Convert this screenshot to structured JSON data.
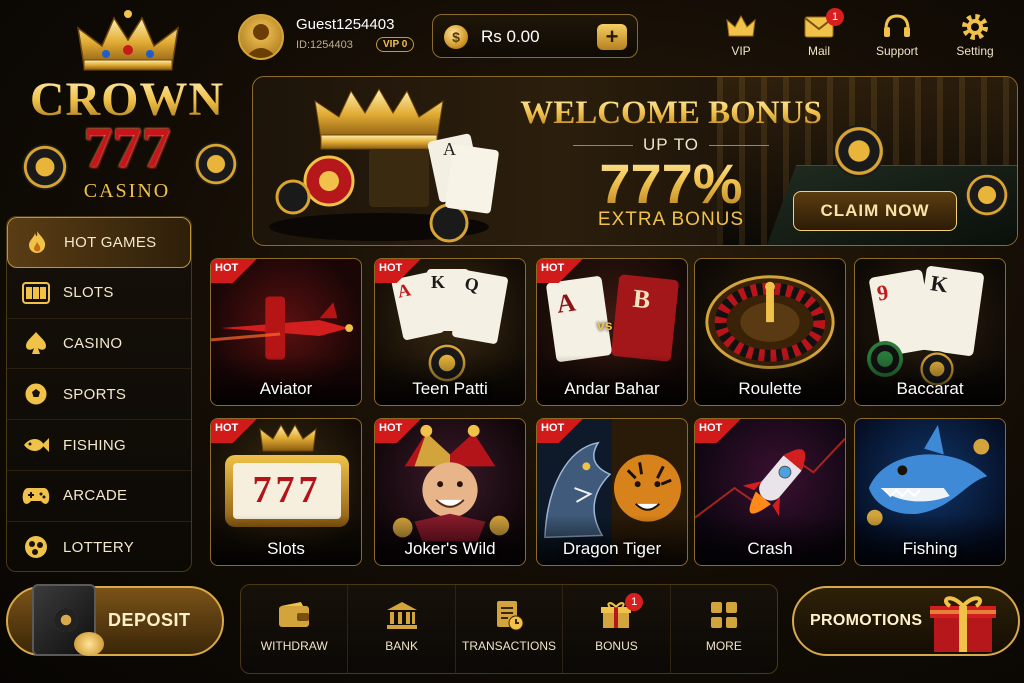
{
  "logo": {
    "word1": "CROWN",
    "word2": "777",
    "word3": "CASINO"
  },
  "user": {
    "name": "Guest1254403",
    "id": "ID:1254403",
    "vip": "VIP 0"
  },
  "balance": {
    "value": "Rs 0.00",
    "currency_icon": "dollar-coin-icon",
    "add_label": "+"
  },
  "top_nav": [
    {
      "label": "VIP",
      "icon": "crown-icon"
    },
    {
      "label": "Mail",
      "icon": "mail-icon",
      "badge": "1"
    },
    {
      "label": "Support",
      "icon": "headset-icon"
    },
    {
      "label": "Setting",
      "icon": "gear-icon"
    }
  ],
  "banner": {
    "title": "WELCOME BONUS",
    "subtitle": "UP TO",
    "amount": "777%",
    "extra": "EXTRA BONUS",
    "cta": "CLAIM NOW",
    "card1": "A"
  },
  "sidebar": {
    "items": [
      {
        "label": "HOT GAMES",
        "icon": "flame-icon",
        "active": true
      },
      {
        "label": "SLOTS",
        "icon": "slot-machine-icon"
      },
      {
        "label": "CASINO",
        "icon": "spade-icon"
      },
      {
        "label": "SPORTS",
        "icon": "soccer-ball-icon"
      },
      {
        "label": "FISHING",
        "icon": "fish-icon"
      },
      {
        "label": "ARCADE",
        "icon": "gamepad-icon"
      },
      {
        "label": "LOTTERY",
        "icon": "lottery-balls-icon"
      }
    ]
  },
  "games": [
    {
      "name": "Aviator",
      "hot": "HOT"
    },
    {
      "name": "Teen Patti",
      "hot": "HOT",
      "cards": [
        "A",
        "K",
        "Q"
      ]
    },
    {
      "name": "Andar Bahar",
      "hot": "HOT",
      "cards": [
        "A",
        "vs",
        "B"
      ]
    },
    {
      "name": "Roulette"
    },
    {
      "name": "Baccarat",
      "cards": [
        "9",
        "K"
      ]
    },
    {
      "name": "Slots",
      "hot": "HOT",
      "reel": "777"
    },
    {
      "name": "Joker's Wild",
      "hot": "HOT"
    },
    {
      "name": "Dragon Tiger",
      "hot": "HOT"
    },
    {
      "name": "Crash",
      "hot": "HOT"
    },
    {
      "name": "Fishing"
    }
  ],
  "bottom": {
    "deposit": "DEPOSIT",
    "menu": [
      {
        "label": "WITHDRAW",
        "icon": "wallet-icon"
      },
      {
        "label": "BANK",
        "icon": "bank-icon"
      },
      {
        "label": "TRANSACTIONS",
        "icon": "transactions-icon"
      },
      {
        "label": "BONUS",
        "icon": "gift-icon",
        "badge": "1"
      },
      {
        "label": "MORE",
        "icon": "grid-icon"
      }
    ],
    "promotions": "PROMOTIONS"
  },
  "colors": {
    "gold": "#f0c24a",
    "hot_red": "#d11a1a",
    "background": "#120c05"
  }
}
